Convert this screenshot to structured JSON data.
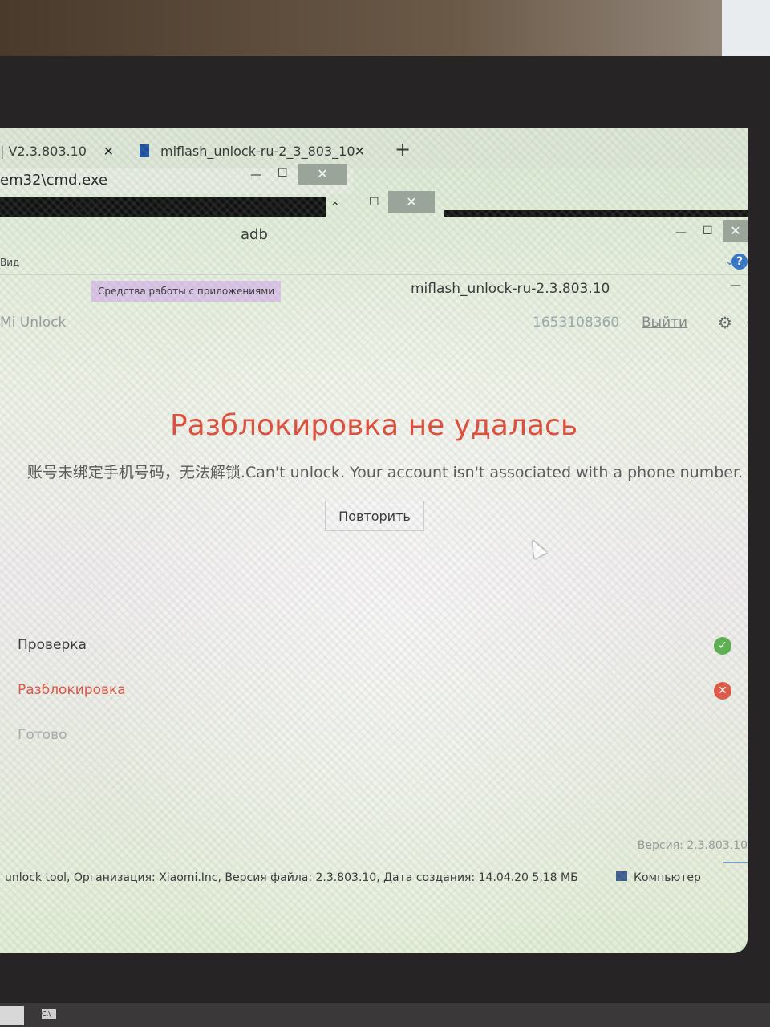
{
  "browser": {
    "tab1_title": "| V2.3.803.10",
    "tab2_title": "miflash_unlock-ru-2_3_803_10",
    "close_glyph": "✕",
    "new_tab_glyph": "+"
  },
  "cmd": {
    "title": "em32\\cmd.exe"
  },
  "explorer": {
    "window_title": "adb",
    "ribbon_view": "Вид",
    "tools_label": "Средства работы с приложениями",
    "folder_title": "miflash_unlock-ru-2.3.803.10",
    "status_text": "unlock tool, Организация: Xiaomi.Inc, Версия файла: 2.3.803.10, Дата создания: 14.04.20 5,18 МБ",
    "computer_label": "Компьютер"
  },
  "miunlock": {
    "app_name": "Mi Unlock",
    "account_id": "1653108360",
    "logout_label": "Выйти",
    "fail_title": "Разблокировка не удалась",
    "fail_message": "账号未绑定手机号码，无法解锁.Can't unlock. Your account isn't associated with a phone number.",
    "retry_label": "Повторить",
    "steps": [
      {
        "label": "Проверка",
        "status": "done"
      },
      {
        "label": "Разблокировка",
        "status": "failed"
      },
      {
        "label": "Готово",
        "status": "pending"
      }
    ],
    "version": "Версия: 2.3.803.10"
  },
  "colors": {
    "error": "#e04a36",
    "success": "#5bb04e",
    "accent_blue": "#2f73c9"
  },
  "icons": {
    "ok": "check-circle-icon",
    "err": "x-circle-icon",
    "gear": "gear-icon",
    "help": "help-icon"
  }
}
